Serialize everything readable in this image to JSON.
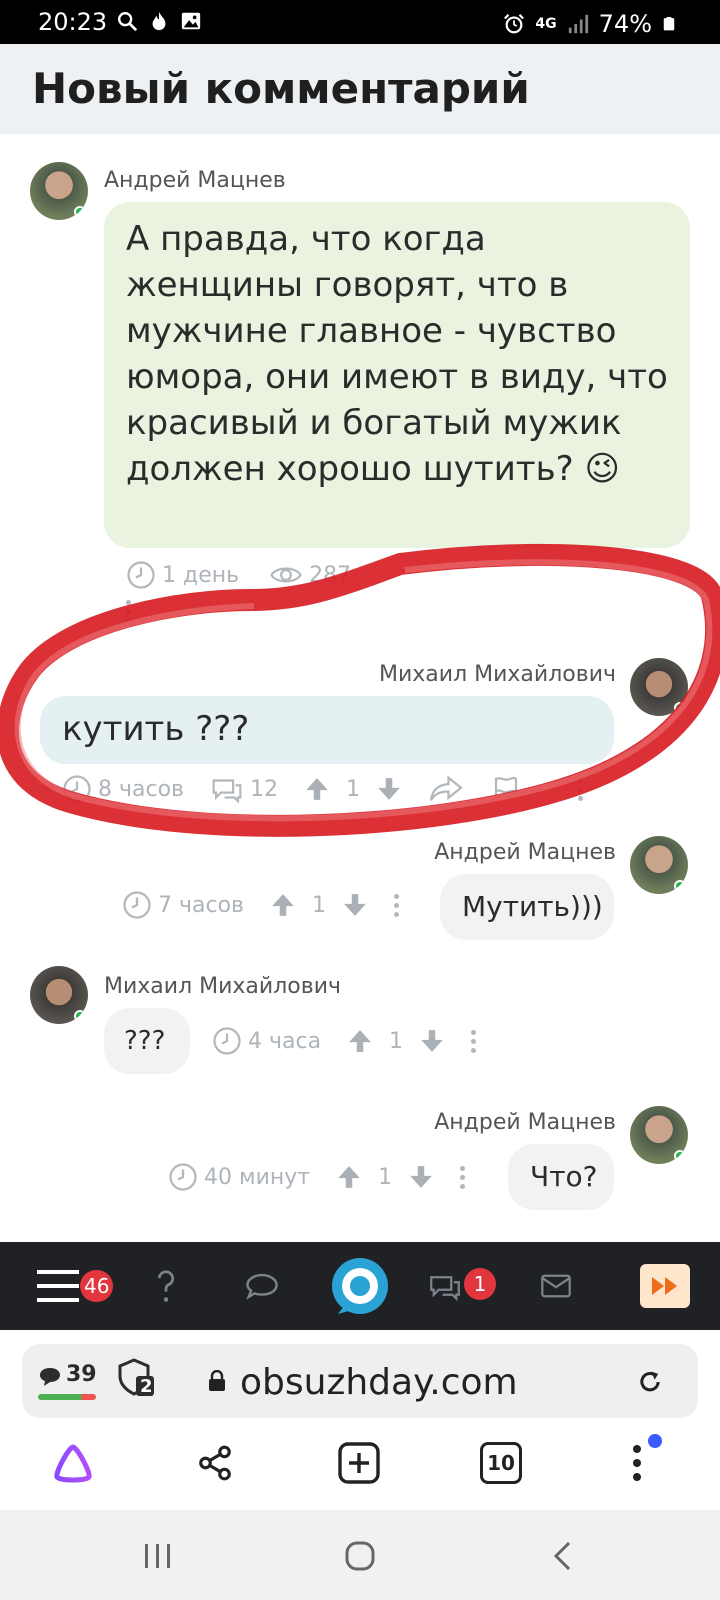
{
  "status_bar": {
    "time": "20:23",
    "network": "4G",
    "battery": "74%",
    "icons": [
      "search-icon",
      "flame-icon",
      "image-icon",
      "alarm-icon",
      "signal-icon",
      "battery-icon"
    ]
  },
  "header": {
    "title": "Новый комментарий"
  },
  "comments": [
    {
      "author": "Андрей Мацнев",
      "text": "А правда, что когда женщины говорят, что в мужчине главное - чувство юмора, они имеют в виду, что красивый и богатый мужик должен хорошо шутить? 😉",
      "time": "1 день",
      "views": "287"
    },
    {
      "author": "Михаил Михайлович",
      "text": "кутить ???",
      "time": "8 часов",
      "replies": "12",
      "votes": "1"
    },
    {
      "author": "Андрей Мацнев",
      "text": "Мутить)))",
      "time": "7 часов",
      "votes": "1"
    },
    {
      "author": "Михаил Михайлович",
      "text": "???",
      "time": "4 часа",
      "votes": "1"
    },
    {
      "author": "Андрей Мацнев",
      "text": "Что?",
      "time": "40 минут",
      "votes": "1"
    }
  ],
  "site_nav": {
    "menu_badge": "46",
    "messages_badge": "1"
  },
  "browser": {
    "comments_count": "39",
    "shield_count": "2",
    "url": "obsuzhday.com",
    "tabs_count": "10"
  },
  "colors": {
    "bubble_green": "#e9f3df",
    "bubble_blue": "#e4f0f1",
    "bubble_gray": "#f1f2f4",
    "online": "#28b14c",
    "badge": "#e2363e",
    "annotation": "#d71920",
    "accent": "#2aa3d4"
  }
}
